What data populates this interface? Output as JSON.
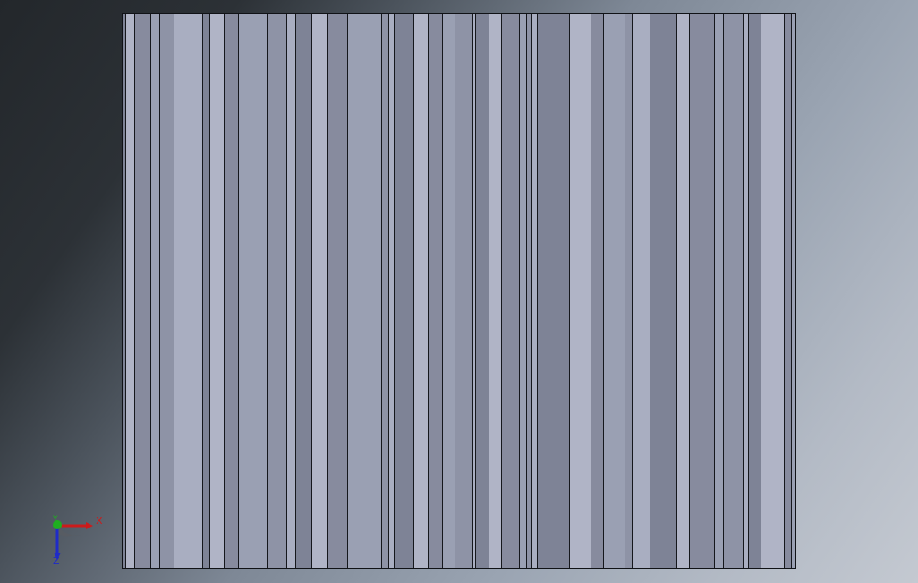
{
  "viewport": {
    "background_colors": [
      "#23272b",
      "#4b535c",
      "#9aa4b2",
      "#c4c9d1"
    ]
  },
  "model": {
    "stripe_colors": [
      "#9aa0b3",
      "#8e93a6",
      "#a9aec1",
      "#7e8396",
      "#b0b4c6",
      "#878b9e"
    ]
  },
  "triad": {
    "x_label": "X",
    "y_label": "Y",
    "z_label": "Z",
    "x_color": "#cc1b1b",
    "y_color": "#1fae1f",
    "z_color": "#1f2bc8"
  }
}
